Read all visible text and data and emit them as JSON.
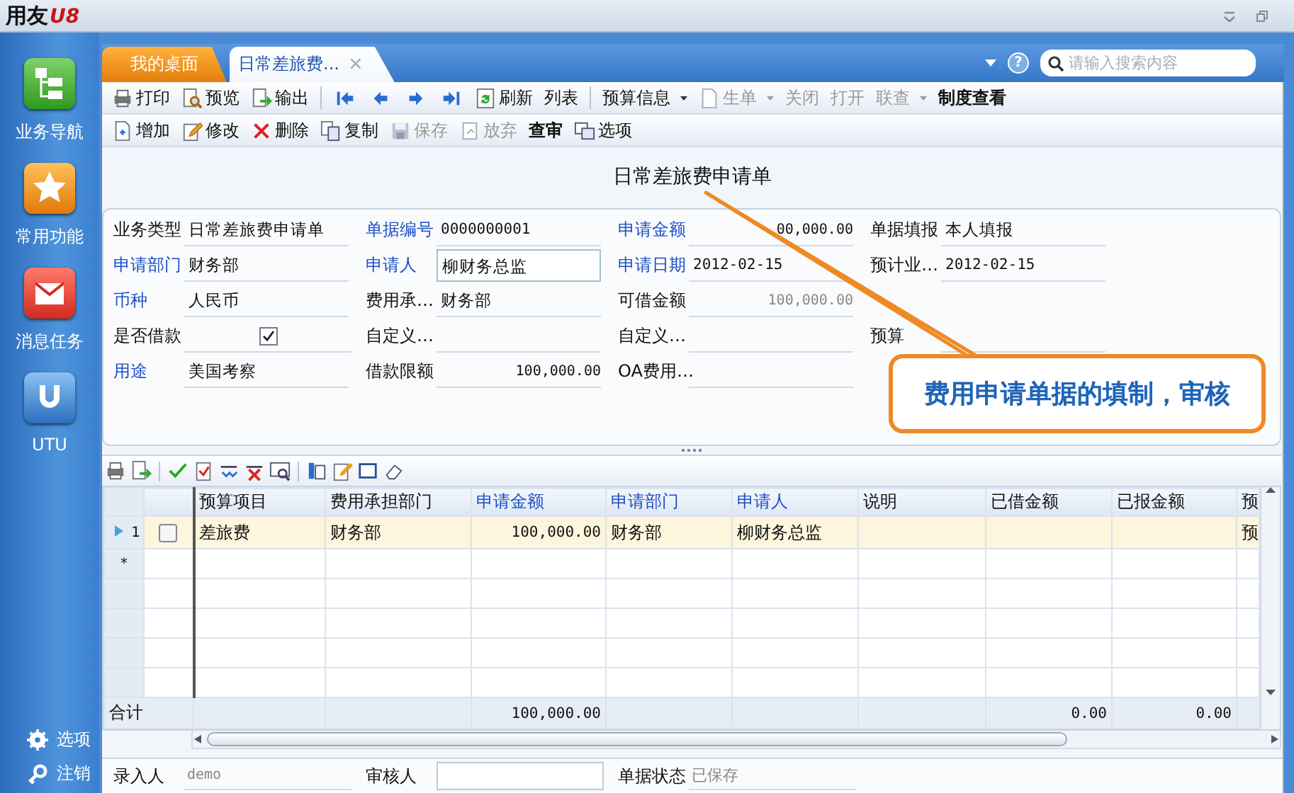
{
  "app": {
    "logo": "用友",
    "logo_badge": "U8"
  },
  "sidebar": {
    "items": [
      {
        "label": "业务导航",
        "kind": "nav"
      },
      {
        "label": "常用功能",
        "kind": "star"
      },
      {
        "label": "消息任务",
        "kind": "mail"
      },
      {
        "label": "UTU",
        "kind": "utu"
      }
    ],
    "bottom": [
      {
        "label": "选项",
        "kind": "gear"
      },
      {
        "label": "注销",
        "kind": "key"
      }
    ]
  },
  "tabs": [
    {
      "label": "我的桌面",
      "selected": false
    },
    {
      "label": "日常差旅费...",
      "selected": true,
      "close": "×"
    }
  ],
  "help_button": "?",
  "search": {
    "placeholder": "请输入搜索内容"
  },
  "toolbar_1": [
    {
      "kind": "button",
      "label": "打印",
      "disabled": false,
      "menu": false,
      "emphasis": false
    },
    {
      "kind": "button",
      "label": "预览",
      "disabled": false,
      "menu": false,
      "emphasis": false
    },
    {
      "kind": "button",
      "label": "输出",
      "disabled": false,
      "menu": false,
      "emphasis": false
    },
    {
      "kind": "separator"
    },
    {
      "kind": "icon"
    },
    {
      "kind": "icon"
    },
    {
      "kind": "icon"
    },
    {
      "kind": "icon"
    },
    {
      "kind": "button",
      "label": "刷新",
      "disabled": false,
      "menu": false,
      "emphasis": false
    },
    {
      "kind": "button",
      "label": "列表",
      "disabled": false,
      "menu": false,
      "emphasis": false
    },
    {
      "kind": "separator"
    },
    {
      "kind": "button",
      "label": "预算信息",
      "disabled": false,
      "menu": true,
      "emphasis": false
    },
    {
      "kind": "button",
      "label": "生单",
      "disabled": true,
      "menu": true,
      "emphasis": false
    },
    {
      "kind": "button",
      "label": "关闭",
      "disabled": true,
      "menu": false,
      "emphasis": false
    },
    {
      "kind": "button",
      "label": "打开",
      "disabled": true,
      "menu": false,
      "emphasis": false
    },
    {
      "kind": "button",
      "label": "联查",
      "disabled": true,
      "menu": true,
      "emphasis": false
    },
    {
      "kind": "button",
      "label": "制度查看",
      "disabled": false,
      "menu": false,
      "emphasis": true
    }
  ],
  "toolbar_2": [
    {
      "kind": "button",
      "label": "增加",
      "disabled": false,
      "menu": false,
      "emphasis": false
    },
    {
      "kind": "button",
      "label": "修改",
      "disabled": false,
      "menu": false,
      "emphasis": false
    },
    {
      "kind": "button",
      "label": "删除",
      "disabled": false,
      "menu": false,
      "emphasis": false
    },
    {
      "kind": "button",
      "label": "复制",
      "disabled": false,
      "menu": false,
      "emphasis": false
    },
    {
      "kind": "button",
      "label": "保存",
      "disabled": true,
      "menu": false,
      "emphasis": false
    },
    {
      "kind": "button",
      "label": "放弃",
      "disabled": true,
      "menu": false,
      "emphasis": false
    },
    {
      "kind": "button",
      "label": "查审",
      "disabled": false,
      "menu": false,
      "emphasis": true
    },
    {
      "kind": "button",
      "label": "选项",
      "disabled": false,
      "menu": false,
      "emphasis": false
    }
  ],
  "form": {
    "title": "日常差旅费申请单",
    "fields": [
      {
        "kind": "text",
        "label": "业务类型",
        "value": "日常差旅费申请单",
        "required": false,
        "focused": false,
        "readonly": false
      },
      {
        "kind": "text",
        "label": "单据编号",
        "value": "0000000001",
        "required": true,
        "focused": false,
        "readonly": false
      },
      {
        "kind": "amount",
        "label": "申请金额",
        "value": "00,000.00",
        "required": true,
        "focused": false,
        "readonly": false
      },
      {
        "kind": "text",
        "label": "单据填报",
        "value": "本人填报",
        "required": false,
        "focused": false,
        "readonly": false
      },
      {
        "kind": "text",
        "label": "申请部门",
        "value": "财务部",
        "required": true,
        "focused": false,
        "readonly": false
      },
      {
        "kind": "text",
        "label": "申请人",
        "value": "柳财务总监",
        "required": true,
        "focused": true,
        "readonly": false
      },
      {
        "kind": "text",
        "label": "申请日期",
        "value": "2012-02-15",
        "required": true,
        "focused": false,
        "readonly": false
      },
      {
        "kind": "text",
        "label": "预计业…",
        "value": "2012-02-15",
        "required": false,
        "focused": false,
        "readonly": false
      },
      {
        "kind": "text",
        "label": "币种",
        "value": "人民币",
        "required": true,
        "focused": false,
        "readonly": false
      },
      {
        "kind": "text",
        "label": "费用承…",
        "value": "财务部",
        "required": false,
        "focused": false,
        "readonly": false
      },
      {
        "kind": "amount",
        "label": "可借金额",
        "value": "100,000.00",
        "required": false,
        "focused": false,
        "readonly": true
      },
      {
        "kind": "blank"
      },
      {
        "kind": "checkbox",
        "label": "是否借款",
        "checked": true,
        "required": false
      },
      {
        "kind": "text",
        "label": "自定义…",
        "required": false,
        "focused": false
      },
      {
        "kind": "text",
        "label": "自定义…",
        "required": false,
        "focused": false
      },
      {
        "kind": "text",
        "label": "预算",
        "required": false,
        "focused": false
      },
      {
        "kind": "text",
        "label": "用途",
        "value": "美国考察",
        "required": true,
        "focused": false,
        "readonly": false
      },
      {
        "kind": "amount",
        "label": "借款限额",
        "value": "100,000.00",
        "required": false,
        "focused": false,
        "readonly": false
      },
      {
        "kind": "text",
        "label": "OA费用…",
        "required": false,
        "focused": false
      }
    ]
  },
  "callout": {
    "text": "费用申请单据的填制，审核"
  },
  "grid": {
    "columns": [
      {
        "label": "预算项目",
        "required": false
      },
      {
        "label": "费用承担部门",
        "required": false
      },
      {
        "label": "申请金额",
        "required": true,
        "kind": "amount"
      },
      {
        "label": "申请部门",
        "required": true
      },
      {
        "label": "申请人",
        "required": true
      },
      {
        "label": "说明",
        "required": false
      },
      {
        "label": "已借金额",
        "required": false,
        "kind": "amount"
      },
      {
        "label": "已报金额",
        "required": false,
        "kind": "amount"
      },
      {
        "label": "预",
        "required": false
      }
    ],
    "rows": [
      {
        "number": "1",
        "selected": true,
        "checked": false,
        "cells": [
          "差旅费",
          "财务部",
          "100,000.00",
          "财务部",
          "柳财务总监",
          null,
          null,
          null,
          "预"
        ]
      }
    ],
    "new_row_marker": "*",
    "totals": {
      "label": "合计",
      "cells": [
        null,
        null,
        "100,000.00",
        null,
        null,
        null,
        "0.00",
        "0.00",
        null
      ]
    }
  },
  "footer": [
    {
      "kind": "text",
      "label": "录入人",
      "value": "demo"
    },
    {
      "kind": "input",
      "label": "审核人"
    },
    {
      "kind": "text",
      "label": "单据状态",
      "value": "已保存"
    }
  ]
}
